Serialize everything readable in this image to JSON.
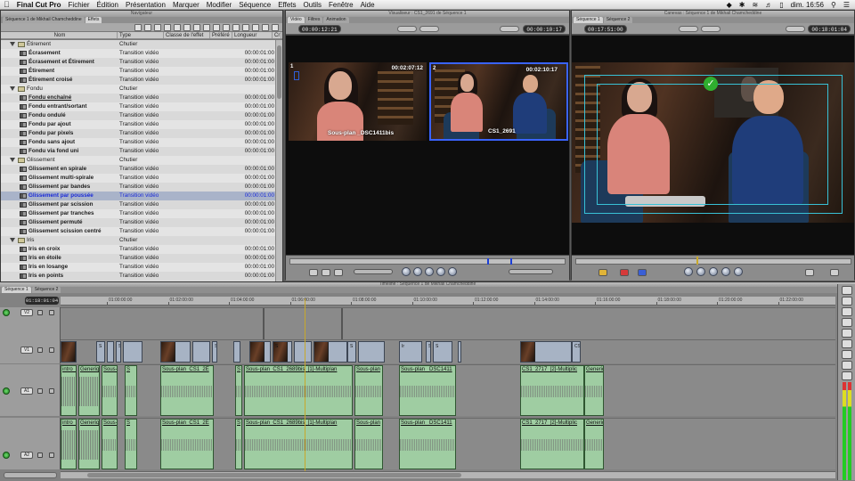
{
  "menubar": {
    "app": "Final Cut Pro",
    "items": [
      "Fichier",
      "Édition",
      "Présentation",
      "Marquer",
      "Modifier",
      "Séquence",
      "Effets",
      "Outils",
      "Fenêtre",
      "Aide"
    ],
    "clock": "dim. 16:56"
  },
  "browser": {
    "title": "Navigateur",
    "tabs": [
      "Séquence 1 de Mikhail Chamcheddine",
      "Effets"
    ],
    "columns": [
      "Nom",
      "Type",
      "Classe de l'effet",
      "Préféré",
      "Longueur",
      "Cr"
    ],
    "rows": [
      {
        "name": "Étirement",
        "type": "Chutier",
        "dur": "",
        "kind": "bin"
      },
      {
        "name": "Écrasement",
        "type": "Transition vidéo",
        "dur": "00:00:01:00",
        "kind": "item"
      },
      {
        "name": "Écrasement et Étirement",
        "type": "Transition vidéo",
        "dur": "00:00:01:00",
        "kind": "item"
      },
      {
        "name": "Étirement",
        "type": "Transition vidéo",
        "dur": "00:00:01:00",
        "kind": "item"
      },
      {
        "name": "Étirement croisé",
        "type": "Transition vidéo",
        "dur": "00:00:01:00",
        "kind": "item"
      },
      {
        "name": "Fondu",
        "type": "Chutier",
        "dur": "",
        "kind": "bin"
      },
      {
        "name": "Fondu enchaîné",
        "type": "Transition vidéo",
        "dur": "00:00:01:00",
        "kind": "item",
        "underline": true
      },
      {
        "name": "Fondu entrant/sortant",
        "type": "Transition vidéo",
        "dur": "00:00:01:00",
        "kind": "item"
      },
      {
        "name": "Fondu ondulé",
        "type": "Transition vidéo",
        "dur": "00:00:01:00",
        "kind": "item"
      },
      {
        "name": "Fondu par ajout",
        "type": "Transition vidéo",
        "dur": "00:00:01:00",
        "kind": "item"
      },
      {
        "name": "Fondu par pixels",
        "type": "Transition vidéo",
        "dur": "00:00:01:00",
        "kind": "item"
      },
      {
        "name": "Fondu sans ajout",
        "type": "Transition vidéo",
        "dur": "00:00:01:00",
        "kind": "item"
      },
      {
        "name": "Fondu via fond uni",
        "type": "Transition vidéo",
        "dur": "00:00:01:00",
        "kind": "item"
      },
      {
        "name": "Glissement",
        "type": "Chutier",
        "dur": "",
        "kind": "bin"
      },
      {
        "name": "Glissement en spirale",
        "type": "Transition vidéo",
        "dur": "00:00:01:00",
        "kind": "item"
      },
      {
        "name": "Glissement multi-spirale",
        "type": "Transition vidéo",
        "dur": "00:00:01:00",
        "kind": "item"
      },
      {
        "name": "Glissement par bandes",
        "type": "Transition vidéo",
        "dur": "00:00:01:00",
        "kind": "item"
      },
      {
        "name": "Glissement par poussée",
        "type": "Transition vidéo",
        "dur": "00:00:01:00",
        "kind": "item",
        "selected": true
      },
      {
        "name": "Glissement par scission",
        "type": "Transition vidéo",
        "dur": "00:00:01:00",
        "kind": "item"
      },
      {
        "name": "Glissement par tranches",
        "type": "Transition vidéo",
        "dur": "00:00:01:00",
        "kind": "item"
      },
      {
        "name": "Glissement permuté",
        "type": "Transition vidéo",
        "dur": "00:00:01:00",
        "kind": "item"
      },
      {
        "name": "Glissement scission centré",
        "type": "Transition vidéo",
        "dur": "00:00:01:00",
        "kind": "item"
      },
      {
        "name": "Iris",
        "type": "Chutier",
        "dur": "",
        "kind": "bin"
      },
      {
        "name": "Iris en croix",
        "type": "Transition vidéo",
        "dur": "00:00:01:00",
        "kind": "item"
      },
      {
        "name": "Iris en étoile",
        "type": "Transition vidéo",
        "dur": "00:00:01:00",
        "kind": "item"
      },
      {
        "name": "Iris en losange",
        "type": "Transition vidéo",
        "dur": "00:00:01:00",
        "kind": "item"
      },
      {
        "name": "Iris en points",
        "type": "Transition vidéo",
        "dur": "00:00:01:00",
        "kind": "item"
      }
    ]
  },
  "viewer": {
    "title": "Visualiseur : CS1_2691 de Séquence 1",
    "tabs": [
      "Vidéo",
      "Filtres",
      "Animation"
    ],
    "timecode_left": "00:00:12:21",
    "timecode_right": "00:00:10:17",
    "zoom": "15%",
    "angles": [
      {
        "num": "1",
        "tc": "00:02:07:12",
        "name": "Sous-plan _DSC1411bis"
      },
      {
        "num": "2",
        "tc": "00:02:10:17",
        "name": "CS1_2691"
      }
    ]
  },
  "canvas": {
    "title": "Canevas : Séquence 1 de Mikhail Chamcheddine",
    "tabs": [
      "Séquence 1",
      "Séquence 2"
    ],
    "timecode_left": "00:17:51:00",
    "timecode_right": "00:18:01:04",
    "zoom": "15%"
  },
  "timeline": {
    "title": "Timeline : Séquence 1 de Mikhail Chamcheddine",
    "tabs": [
      "Séquence 1",
      "Séquence 2"
    ],
    "timecode": "01:18:01:04",
    "ruler": [
      "01:00:00:00",
      "01:02:00:00",
      "01:04:00:00",
      "01:06:00:00",
      "01:08:00:00",
      "01:10:00:00",
      "01:12:00:00",
      "01:14:00:00",
      "01:16:00:00",
      "01:18:00:00",
      "01:20:00:00",
      "01:22:00:00",
      "01:24:00:00"
    ],
    "tracks": {
      "video": "V1",
      "audio1": "A1",
      "audio2": "A2"
    },
    "video_clip_labels": [
      "S",
      "S",
      "S",
      "S",
      "Ir",
      "S",
      "S",
      "S",
      "CS"
    ],
    "audio_clips": [
      "intro_",
      "Generiq",
      "Sous-",
      "S",
      "Sous-plan_CS1_2E",
      "S",
      "Sous-plan_CS1_2689bis_[1]-Multiplan",
      "Sous-plan",
      "Sous-plan _DSC1411",
      "CS1_2717_[2]-Multiplic",
      "Generiq"
    ]
  }
}
